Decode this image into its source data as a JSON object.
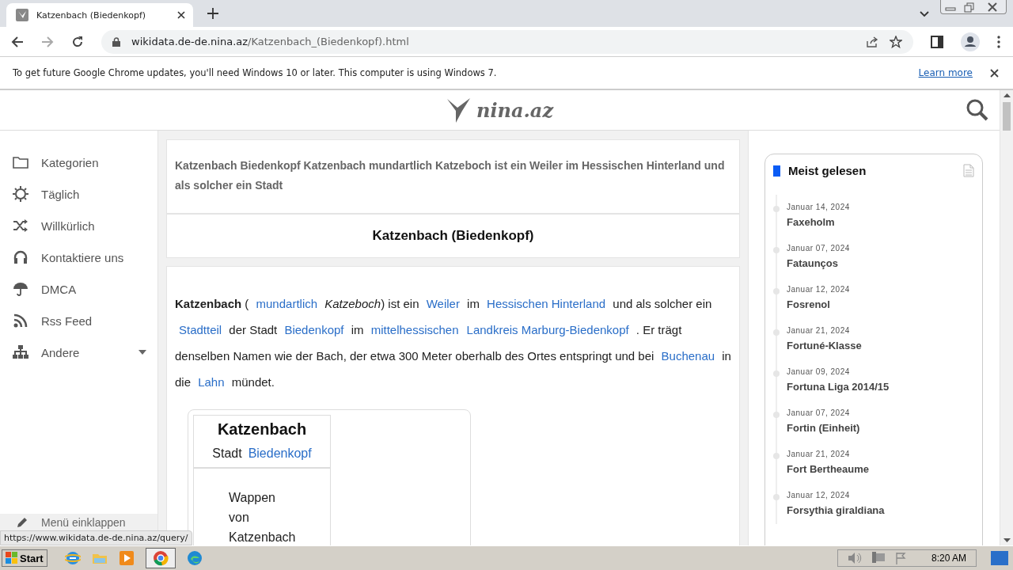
{
  "browser": {
    "tab_title": "Katzenbach (Biedenkopf)",
    "url_domain": "wikidata.de-de.nina.az",
    "url_path": "/Katzenbach_(Biedenkopf).html",
    "notice": "To get future Google Chrome updates, you'll need Windows 10 or later. This computer is using Windows 7.",
    "notice_link": "Learn more",
    "status_url": "https://www.wikidata.de-de.nina.az/query/"
  },
  "site": {
    "logo_text": "nina.az"
  },
  "sidebar": {
    "items": [
      {
        "label": "Kategorien",
        "has_submenu": false
      },
      {
        "label": "Täglich",
        "has_submenu": false
      },
      {
        "label": "Willkürlich",
        "has_submenu": false
      },
      {
        "label": "Kontaktiere uns",
        "has_submenu": false
      },
      {
        "label": "DMCA",
        "has_submenu": false
      },
      {
        "label": "Rss Feed",
        "has_submenu": false
      },
      {
        "label": "Andere",
        "has_submenu": true
      }
    ],
    "collapse_label": "Menü einklappen"
  },
  "article": {
    "summary": "Katzenbach Biedenkopf Katzenbach mundartlich Katzeboch ist ein Weiler im Hessischen Hinterland und als solcher ein Stadt",
    "title": "Katzenbach (Biedenkopf)",
    "paragraph": [
      {
        "kind": "bold",
        "text": "Katzenbach"
      },
      {
        "kind": "text",
        "text": " ( "
      },
      {
        "kind": "link",
        "text": "mundartlich"
      },
      {
        "kind": "italic",
        "text": " Katzeboch"
      },
      {
        "kind": "text",
        "text": ") ist ein "
      },
      {
        "kind": "link",
        "text": "Weiler"
      },
      {
        "kind": "text",
        "text": " im "
      },
      {
        "kind": "link",
        "text": "Hessischen Hinterland"
      },
      {
        "kind": "text",
        "text": " und als solcher ein "
      },
      {
        "kind": "link",
        "text": "Stadtteil"
      },
      {
        "kind": "text",
        "text": " der Stadt "
      },
      {
        "kind": "link",
        "text": "Biedenkopf"
      },
      {
        "kind": "text",
        "text": " im "
      },
      {
        "kind": "link",
        "text": "mittelhessischen"
      },
      {
        "kind": "link",
        "text": "Landkreis Marburg-Biedenkopf"
      },
      {
        "kind": "text",
        "text": " . Er trägt denselben Namen wie der Bach, der etwa 300 Meter oberhalb des Ortes entspringt und bei "
      },
      {
        "kind": "link",
        "text": "Buchenau"
      },
      {
        "kind": "text",
        "text": " in die "
      },
      {
        "kind": "link",
        "text": "Lahn"
      },
      {
        "kind": "text",
        "text": " mündet."
      }
    ],
    "infobox": {
      "title": "Katzenbach",
      "type_label": "Stadt",
      "type_link": "Biedenkopf",
      "caption": "Wappen von Katzenbach"
    }
  },
  "most_read": {
    "title": "Meist gelesen",
    "items": [
      {
        "date": "Januar 14, 2024",
        "title": "Faxeholm"
      },
      {
        "date": "Januar 07, 2024",
        "title": "Fataunços"
      },
      {
        "date": "Januar 12, 2024",
        "title": "Fosrenol"
      },
      {
        "date": "Januar 21, 2024",
        "title": "Fortuné-Klasse"
      },
      {
        "date": "Januar 09, 2024",
        "title": "Fortuna Liga 2014/15"
      },
      {
        "date": "Januar 07, 2024",
        "title": "Fortin (Einheit)"
      },
      {
        "date": "Januar 21, 2024",
        "title": "Fort Bertheaume"
      },
      {
        "date": "Januar 12, 2024",
        "title": "Forsythia giraldiana"
      }
    ]
  },
  "taskbar": {
    "start_label": "Start",
    "clock": "8:20 AM"
  }
}
